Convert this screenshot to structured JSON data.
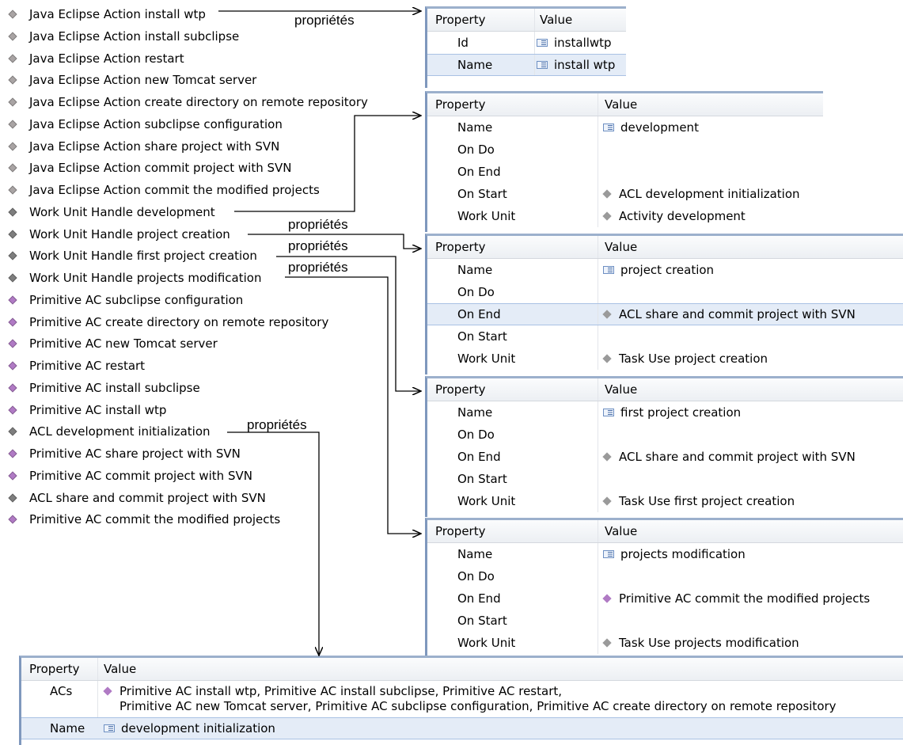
{
  "colors": {
    "gray_diamond": "#a9a4a4",
    "purple_diamond": "#b07ac4",
    "dark_diamond": "#7e7e7e",
    "panel_border": "#7f98bd"
  },
  "tree_items": [
    {
      "label": "Java Eclipse Action install wtp",
      "icon": "gray-diamond-icon"
    },
    {
      "label": "Java Eclipse Action install subclipse",
      "icon": "gray-diamond-icon"
    },
    {
      "label": "Java Eclipse Action restart",
      "icon": "gray-diamond-icon"
    },
    {
      "label": "Java Eclipse Action new Tomcat server",
      "icon": "gray-diamond-icon"
    },
    {
      "label": "Java Eclipse Action create directory on remote repository",
      "icon": "gray-diamond-icon"
    },
    {
      "label": "Java Eclipse Action subclipse configuration",
      "icon": "gray-diamond-icon"
    },
    {
      "label": "Java Eclipse Action share project with SVN",
      "icon": "gray-diamond-icon"
    },
    {
      "label": "Java Eclipse Action commit project with SVN",
      "icon": "gray-diamond-icon"
    },
    {
      "label": "Java Eclipse Action commit the modified projects",
      "icon": "gray-diamond-icon"
    },
    {
      "label": "Work Unit Handle development",
      "icon": "dark-diamond-icon"
    },
    {
      "label": "Work Unit Handle project creation",
      "icon": "dark-diamond-icon"
    },
    {
      "label": "Work Unit Handle first project creation",
      "icon": "dark-diamond-icon"
    },
    {
      "label": "Work Unit Handle projects modification",
      "icon": "dark-diamond-icon"
    },
    {
      "label": "Primitive AC subclipse configuration",
      "icon": "purple-diamond-icon"
    },
    {
      "label": "Primitive AC create directory on remote repository",
      "icon": "purple-diamond-icon"
    },
    {
      "label": "Primitive AC new Tomcat server",
      "icon": "purple-diamond-icon"
    },
    {
      "label": "Primitive AC restart",
      "icon": "purple-diamond-icon"
    },
    {
      "label": "Primitive AC install subclipse",
      "icon": "purple-diamond-icon"
    },
    {
      "label": "Primitive AC install wtp",
      "icon": "purple-diamond-icon"
    },
    {
      "label": "ACL development initialization",
      "icon": "dark-diamond-icon"
    },
    {
      "label": "Primitive AC share project with SVN",
      "icon": "purple-diamond-icon"
    },
    {
      "label": "Primitive AC commit project with SVN",
      "icon": "purple-diamond-icon"
    },
    {
      "label": "ACL share and commit project with SVN",
      "icon": "dark-diamond-icon"
    },
    {
      "label": "Primitive AC commit the modified projects",
      "icon": "purple-diamond-icon"
    }
  ],
  "annotation_label": "propriétés",
  "headers": {
    "property": "Property",
    "value": "Value"
  },
  "panels": [
    {
      "rows": [
        {
          "prop": "Id",
          "value": "installwtp",
          "icon": "text-icon"
        },
        {
          "prop": "Name",
          "value": "install wtp",
          "icon": "text-icon",
          "selected": true
        }
      ]
    },
    {
      "rows": [
        {
          "prop": "Name",
          "value": "development",
          "icon": "text-icon"
        },
        {
          "prop": "On Do",
          "value": ""
        },
        {
          "prop": "On End",
          "value": ""
        },
        {
          "prop": "On Start",
          "value": "ACL development initialization",
          "icon": "gray-diamond-icon"
        },
        {
          "prop": "Work Unit",
          "value": "Activity development",
          "icon": "gray-diamond-icon"
        }
      ]
    },
    {
      "rows": [
        {
          "prop": "Name",
          "value": "project creation",
          "icon": "text-icon"
        },
        {
          "prop": "On Do",
          "value": ""
        },
        {
          "prop": "On End",
          "value": "ACL share and commit project with SVN",
          "icon": "gray-diamond-icon",
          "selected": true
        },
        {
          "prop": "On Start",
          "value": ""
        },
        {
          "prop": "Work Unit",
          "value": "Task Use project creation",
          "icon": "gray-diamond-icon"
        }
      ]
    },
    {
      "rows": [
        {
          "prop": "Name",
          "value": "first project creation",
          "icon": "text-icon"
        },
        {
          "prop": "On Do",
          "value": ""
        },
        {
          "prop": "On End",
          "value": "ACL share and commit project with SVN",
          "icon": "gray-diamond-icon"
        },
        {
          "prop": "On Start",
          "value": ""
        },
        {
          "prop": "Work Unit",
          "value": "Task Use first project creation",
          "icon": "gray-diamond-icon"
        }
      ]
    },
    {
      "rows": [
        {
          "prop": "Name",
          "value": "projects modification",
          "icon": "text-icon"
        },
        {
          "prop": "On Do",
          "value": ""
        },
        {
          "prop": "On End",
          "value": "Primitive AC commit the modified projects",
          "icon": "purple-diamond-icon"
        },
        {
          "prop": "On Start",
          "value": ""
        },
        {
          "prop": "Work Unit",
          "value": "Task Use projects modification",
          "icon": "gray-diamond-icon"
        }
      ]
    }
  ],
  "bottom_panel": {
    "acs_prop": "ACs",
    "acs_line1": "Primitive AC install wtp, Primitive AC install subclipse, Primitive AC restart,",
    "acs_line2": "Primitive AC new Tomcat server, Primitive AC subclipse configuration, Primitive AC create directory on remote repository",
    "name_prop": "Name",
    "name_value": "development initialization"
  }
}
